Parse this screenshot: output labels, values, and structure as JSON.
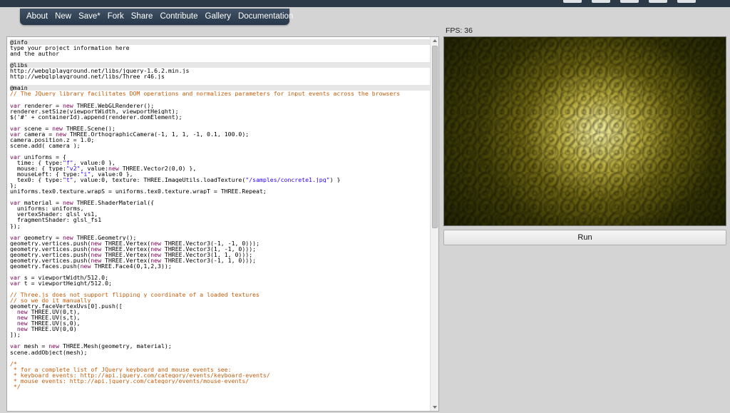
{
  "nav": {
    "items": [
      "About",
      "New",
      "Save*",
      "Fork",
      "Share",
      "Contribute",
      "Gallery",
      "Documentation"
    ]
  },
  "fps_label": "FPS: 36",
  "run_label": "Run",
  "colors": {
    "navbar": "#2f4054",
    "topbar": "#2c3a47",
    "page_background": "#d4d4d4",
    "keyword": "#7f0055",
    "comment": "#c45c0a",
    "string": "#2a00ff"
  },
  "code_lines": [
    {
      "text": "@info",
      "section": true
    },
    {
      "text": "type your project information here"
    },
    {
      "text": "and the author"
    },
    {
      "text": ""
    },
    {
      "text": "@libs",
      "section": true
    },
    {
      "text": "http://webglplayground.net/libs/jquery-1.6.2.min.js"
    },
    {
      "text": "http://webglplayground.net/libs/Three_r46.js"
    },
    {
      "text": ""
    },
    {
      "text": "@main",
      "section": true
    },
    {
      "text": "// The JQuery library facilitates DOM operations and normalizes parameters for input events across the browsers",
      "comment": true
    },
    {
      "text": ""
    },
    {
      "text": "var renderer = new THREE.WebGLRenderer();"
    },
    {
      "text": "renderer.setSize(viewportWidth, viewportHeight);"
    },
    {
      "text": "$('#' + containerId).append(renderer.domElement);"
    },
    {
      "text": ""
    },
    {
      "text": "var scene = new THREE.Scene();"
    },
    {
      "text": "var camera = new THREE.OrthographicCamera(-1, 1, 1, -1, 0.1, 100.0);"
    },
    {
      "text": "camera.position.z = 1.0;"
    },
    {
      "text": "scene.add( camera );"
    },
    {
      "text": ""
    },
    {
      "text": "var uniforms = {"
    },
    {
      "text": "  time: { type:\"f\", value:0 },"
    },
    {
      "text": "  mouse: { type:\"v2\", value:new THREE.Vector2(0,0) },"
    },
    {
      "text": "  mouseLeft: { type:\"i\", value:0 },"
    },
    {
      "text": "  tex0: { type:\"t\", value:0, texture: THREE.ImageUtils.loadTexture(\"/samples/concrete1.jpg\") }"
    },
    {
      "text": "};"
    },
    {
      "text": "uniforms.tex0.texture.wrapS = uniforms.tex0.texture.wrapT = THREE.Repeat;"
    },
    {
      "text": ""
    },
    {
      "text": "var material = new THREE.ShaderMaterial({"
    },
    {
      "text": "  uniforms: uniforms,"
    },
    {
      "text": "  vertexShader: glsl_vs1,"
    },
    {
      "text": "  fragmentShader: glsl_fs1"
    },
    {
      "text": "});"
    },
    {
      "text": ""
    },
    {
      "text": "var geometry = new THREE.Geometry();"
    },
    {
      "text": "geometry.vertices.push(new THREE.Vertex(new THREE.Vector3(-1, -1, 0)));"
    },
    {
      "text": "geometry.vertices.push(new THREE.Vertex(new THREE.Vector3(1, -1, 0)));"
    },
    {
      "text": "geometry.vertices.push(new THREE.Vertex(new THREE.Vector3(1, 1, 0)));"
    },
    {
      "text": "geometry.vertices.push(new THREE.Vertex(new THREE.Vector3(-1, 1, 0)));"
    },
    {
      "text": "geometry.faces.push(new THREE.Face4(0,1,2,3));"
    },
    {
      "text": ""
    },
    {
      "text": "var s = viewportWidth/512.0;"
    },
    {
      "text": "var t = viewportHeight/512.0;"
    },
    {
      "text": ""
    },
    {
      "text": "// Three.js does not support flipping y coordinate of a loaded textures",
      "comment": true
    },
    {
      "text": "// so we do it manually",
      "comment": true
    },
    {
      "text": "geometry.faceVertexUvs[0].push(["
    },
    {
      "text": "  new THREE.UV(0,t),"
    },
    {
      "text": "  new THREE.UV(s,t),"
    },
    {
      "text": "  new THREE.UV(s,0),"
    },
    {
      "text": "  new THREE.UV(0,0)"
    },
    {
      "text": "]);"
    },
    {
      "text": ""
    },
    {
      "text": "var mesh = new THREE.Mesh(geometry, material);"
    },
    {
      "text": "scene.addObject(mesh);"
    },
    {
      "text": ""
    },
    {
      "text": "/*",
      "comment": true
    },
    {
      "text": " * for a complete list of JQuery keyboard and mouse events see:",
      "comment": true
    },
    {
      "text": " * keyboard events: http://api.jquery.com/category/events/keyboard-events/",
      "comment": true
    },
    {
      "text": " * mouse events: http://api.jquery.com/category/events/mouse-events/",
      "comment": true
    },
    {
      "text": " */",
      "comment": true
    }
  ]
}
